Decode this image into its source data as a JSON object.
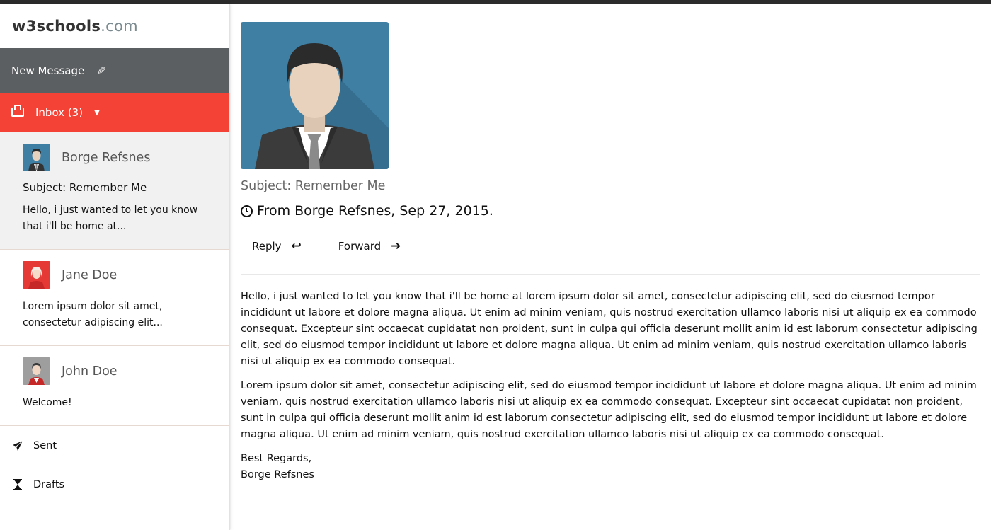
{
  "brand": {
    "logo_main": "w3schools",
    "logo_suffix": ".com"
  },
  "sidebar": {
    "new_message_label": "New Message",
    "inbox_label": "Inbox (3)",
    "mails": [
      {
        "name": "Borge Refsnes",
        "subject": "Subject: Remember Me",
        "preview": "Hello, i just wanted to let you know that i'll be home at..."
      },
      {
        "name": "Jane Doe",
        "preview": "Lorem ipsum dolor sit amet, consectetur adipiscing elit..."
      },
      {
        "name": "John Doe",
        "preview": "Welcome!"
      }
    ],
    "links": [
      {
        "label": "Sent",
        "icon": "paper-plane-icon"
      },
      {
        "label": "Drafts",
        "icon": "hourglass-icon"
      }
    ]
  },
  "main": {
    "subject": "Subject: Remember Me",
    "from": "From Borge Refsnes, Sep 27, 2015.",
    "reply_label": "Reply",
    "forward_label": "Forward",
    "paragraphs": [
      "Hello, i just wanted to let you know that i'll be home at lorem ipsum dolor sit amet, consectetur adipiscing elit, sed do eiusmod tempor incididunt ut labore et dolore magna aliqua. Ut enim ad minim veniam, quis nostrud exercitation ullamco laboris nisi ut aliquip ex ea commodo consequat. Excepteur sint occaecat cupidatat non proident, sunt in culpa qui officia deserunt mollit anim id est laborum consectetur adipiscing elit, sed do eiusmod tempor incididunt ut labore et dolore magna aliqua. Ut enim ad minim veniam, quis nostrud exercitation ullamco laboris nisi ut aliquip ex ea commodo consequat.",
      "Lorem ipsum dolor sit amet, consectetur adipiscing elit, sed do eiusmod tempor incididunt ut labore et dolore magna aliqua. Ut enim ad minim veniam, quis nostrud exercitation ullamco laboris nisi ut aliquip ex ea commodo consequat. Excepteur sint occaecat cupidatat non proident, sunt in culpa qui officia deserunt mollit anim id est laborum consectetur adipiscing elit, sed do eiusmod tempor incididunt ut labore et dolore magna aliqua. Ut enim ad minim veniam, quis nostrud exercitation ullamco laboris nisi ut aliquip ex ea commodo consequat."
    ],
    "signature_line1": "Best Regards,",
    "signature_line2": "Borge Refsnes"
  },
  "colors": {
    "new_message_bg": "#5c5f61",
    "inbox_bg": "#f44336",
    "avatar_blue": "#3f7fa3",
    "avatar_red": "#e53935"
  }
}
